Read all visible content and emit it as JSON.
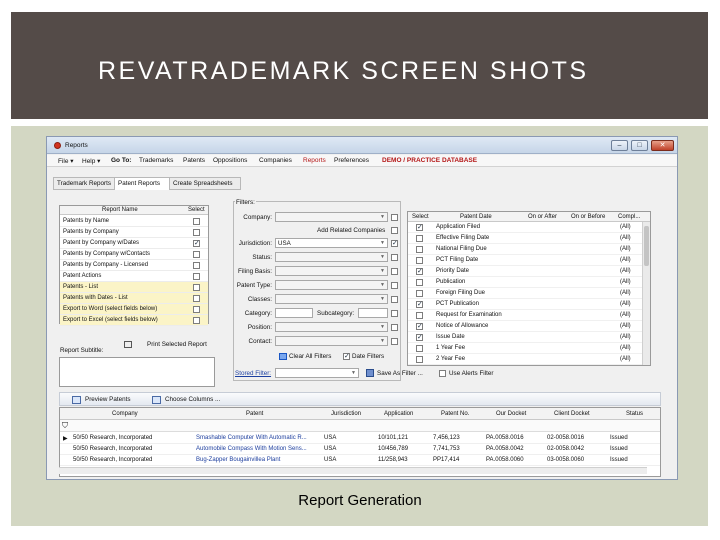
{
  "slide": {
    "title": "REVATRADEMARK SCREEN SHOTS",
    "caption": "Report Generation"
  },
  "window": {
    "title": "Reports",
    "min": "–",
    "max": "□",
    "close": "✕"
  },
  "menu": [
    {
      "label": "File ▾",
      "style": ""
    },
    {
      "label": "Help ▾",
      "style": ""
    },
    {
      "label": "Go To:",
      "style": "bold"
    },
    {
      "label": "Trademarks",
      "style": ""
    },
    {
      "label": "Patents",
      "style": ""
    },
    {
      "label": "Oppositions",
      "style": ""
    },
    {
      "label": "Companies",
      "style": ""
    },
    {
      "label": "Reports",
      "style": "red"
    },
    {
      "label": "Preferences",
      "style": ""
    },
    {
      "label": "DEMO / PRACTICE DATABASE",
      "style": "red"
    }
  ],
  "tabs": [
    "Trademark Reports",
    "Patent Reports",
    "Create Spreadsheets"
  ],
  "active_tab": 1,
  "report_list": {
    "col_name": "Report Name",
    "col_select": "Select",
    "items": [
      {
        "name": "Patents by Name",
        "checked": false,
        "highlight": false
      },
      {
        "name": "Patents by Company",
        "checked": false,
        "highlight": false
      },
      {
        "name": "Patent by Company w/Dates",
        "checked": true,
        "highlight": false
      },
      {
        "name": "Patents by Company w/Contacts",
        "checked": false,
        "highlight": false
      },
      {
        "name": "Patents by Company - Licensed",
        "checked": false,
        "highlight": false
      },
      {
        "name": "Patent Actions",
        "checked": false,
        "highlight": false
      },
      {
        "name": "Patents - List",
        "checked": false,
        "highlight": true
      },
      {
        "name": "Patents with Dates - List",
        "checked": false,
        "highlight": true
      },
      {
        "name": "Export to Word  (select fields below)",
        "checked": false,
        "highlight": true
      },
      {
        "name": "Export to Excel (select fields below)",
        "checked": false,
        "highlight": true
      }
    ]
  },
  "print_button": "Print Selected Report",
  "report_subtitle_label": "Report Subtitle:",
  "filters": {
    "legend": "Filters:",
    "company_label": "Company:",
    "related_label": "Add Related Companies",
    "jurisdiction_label": "Jurisdiction:",
    "jurisdiction_value": "USA",
    "status_label": "Status:",
    "filing_basis_label": "Filing Basis:",
    "patent_type_label": "Patent Type:",
    "classes_label": "Classes:",
    "category_label": "Category:",
    "subcategory_label": "Subcategory:",
    "position_label": "Position:",
    "contact_label": "Contact:",
    "clear_all": "Clear All Filters",
    "date_filters": "Date Filters"
  },
  "date_grid": {
    "headers": [
      "Select",
      "Patent Date",
      "On or After",
      "On or Before",
      "Compl..."
    ],
    "rows": [
      {
        "checked": true,
        "name": "Application Filed",
        "compl": "(All)"
      },
      {
        "checked": false,
        "name": "Effective Filing Date",
        "compl": "(All)"
      },
      {
        "checked": false,
        "name": "National Filing Due",
        "compl": "(All)"
      },
      {
        "checked": false,
        "name": "PCT Filing Date",
        "compl": "(All)"
      },
      {
        "checked": true,
        "name": "Priority Date",
        "compl": "(All)"
      },
      {
        "checked": false,
        "name": "Publication",
        "compl": "(All)"
      },
      {
        "checked": false,
        "name": "Foreign Filing Due",
        "compl": "(All)"
      },
      {
        "checked": true,
        "name": "PCT Publication",
        "compl": "(All)"
      },
      {
        "checked": false,
        "name": "Request for Examination",
        "compl": "(All)"
      },
      {
        "checked": true,
        "name": "Notice of Allowance",
        "compl": "(All)"
      },
      {
        "checked": true,
        "name": "Issue Date",
        "compl": "(All)"
      },
      {
        "checked": false,
        "name": "1 Year Fee",
        "compl": "(All)"
      },
      {
        "checked": false,
        "name": "2 Year Fee",
        "compl": "(All)"
      }
    ]
  },
  "stored_filter": {
    "label": "Stored Filter:",
    "save_as": "Save As Filter ...",
    "use_alerts": "Use Alerts Filter"
  },
  "grid_toolbar": {
    "preview": "Preview Patents",
    "choose_columns": "Choose Columns ..."
  },
  "results": {
    "headers": [
      "Company",
      "Patent",
      "Jurisdiction",
      "Application",
      "Patent No.",
      "Our Docket",
      "Client Docket",
      "Status"
    ],
    "rows": [
      [
        "50/50 Research, Incorporated",
        "Smashable Computer With Automatic R...",
        "USA",
        "10/101,121",
        "7,456,123",
        "PA.0058.0016",
        "02-0058.0016",
        "Issued"
      ],
      [
        "50/50 Research, Incorporated",
        "Automobile Compass With Motion Sens...",
        "USA",
        "10/456,789",
        "7,741,753",
        "PA.0058.0042",
        "02-0058.0042",
        "Issued"
      ],
      [
        "50/50 Research, Incorporated",
        "Bug-Zapper Bougainvillea Plant",
        "USA",
        "11/258,943",
        "PP17,414",
        "PA.0058.0060",
        "03-0058.0060",
        "Issued"
      ]
    ]
  }
}
